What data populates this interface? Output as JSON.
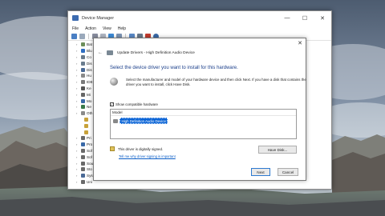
{
  "device_manager": {
    "title": "Device Manager",
    "menu": [
      "File",
      "Action",
      "View",
      "Help"
    ],
    "window_controls": {
      "minimize": "—",
      "maximize": "☐",
      "close": "✕"
    },
    "tree_items": [
      {
        "label": "Bat",
        "icon_color": "#6d8f5b"
      },
      {
        "label": "Blu",
        "icon_color": "#2f6ec2"
      },
      {
        "label": "Co",
        "icon_color": "#6a7a8a"
      },
      {
        "label": "Dis",
        "icon_color": "#6b7d8e"
      },
      {
        "label": "Dis",
        "icon_color": "#4a6a96"
      },
      {
        "label": "Hu",
        "icon_color": "#8a8a8a"
      },
      {
        "label": "IDE",
        "icon_color": "#7a7a7a"
      },
      {
        "label": "Ke",
        "icon_color": "#555555"
      },
      {
        "label": "Mi",
        "icon_color": "#666666"
      },
      {
        "label": "Mo",
        "icon_color": "#3a6aa8"
      },
      {
        "label": "Ne",
        "icon_color": "#3a7a4a"
      },
      {
        "label": "Oth",
        "icon_color": "#8a8a8a"
      },
      {
        "label": "",
        "icon_color": "#c8a23a"
      },
      {
        "label": "",
        "icon_color": "#c8a23a"
      },
      {
        "label": "",
        "icon_color": "#c8a23a"
      },
      {
        "label": "Pri",
        "icon_color": "#6a6a6a"
      },
      {
        "label": "Pro",
        "icon_color": "#3a6aa8"
      },
      {
        "label": "Sof",
        "icon_color": "#6a6a6a"
      },
      {
        "label": "Sof",
        "icon_color": "#6a6a6a"
      },
      {
        "label": "Sou",
        "icon_color": "#6a6a6a"
      },
      {
        "label": "Sto",
        "icon_color": "#6a6a6a"
      },
      {
        "label": "Sys",
        "icon_color": "#4a6a96"
      },
      {
        "label": "Uni",
        "icon_color": "#6a6a6a"
      }
    ]
  },
  "update_dialog": {
    "close": "✕",
    "back_arrow": "←",
    "header_title": "Update Drivers - High Definition Audio Device",
    "heading": "Select the device driver you want to install for this hardware.",
    "description": "Select the manufacturer and model of your hardware device and then click Next. If you have a disk that contains the driver you want to install, click Have Disk.",
    "checkbox_label": "Show compatible hardware",
    "checkbox_checked": true,
    "checkbox_mark": "✓",
    "model_header": "Model",
    "model_items": [
      "High Definition Audio Device"
    ],
    "signed_text": "This driver is digitally signed.",
    "signing_link": "Tell me why driver signing is important",
    "have_disk_label": "Have Disk...",
    "next_label": "Next",
    "cancel_label": "Cancel"
  },
  "colors": {
    "accent": "#0a64d6",
    "heading": "#1a3e8a",
    "link": "#0b5ec7"
  }
}
